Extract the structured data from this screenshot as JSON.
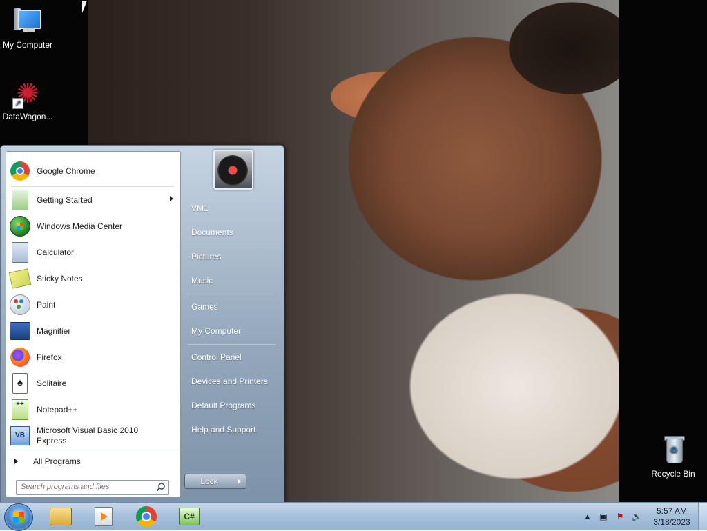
{
  "desktop": {
    "icons": [
      {
        "label": "My Computer",
        "icon": "computer-icon"
      },
      {
        "label": "DataWagon...",
        "icon": "datawagon-icon"
      },
      {
        "label": "Recycle Bin",
        "icon": "recycle-bin-icon"
      }
    ]
  },
  "start_menu": {
    "pinned": [
      {
        "label": "Google Chrome",
        "icon": "chrome-icon"
      }
    ],
    "recent": [
      {
        "label": "Getting Started",
        "icon": "getting-started-icon",
        "has_submenu": true
      },
      {
        "label": "Windows Media Center",
        "icon": "windows-media-center-icon"
      },
      {
        "label": "Calculator",
        "icon": "calculator-icon"
      },
      {
        "label": "Sticky Notes",
        "icon": "sticky-notes-icon"
      },
      {
        "label": "Paint",
        "icon": "paint-icon"
      },
      {
        "label": "Magnifier",
        "icon": "magnifier-icon"
      },
      {
        "label": "Firefox",
        "icon": "firefox-icon"
      },
      {
        "label": "Solitaire",
        "icon": "solitaire-icon"
      },
      {
        "label": "Notepad++",
        "icon": "notepad-plus-plus-icon"
      },
      {
        "label_line1": "Microsoft Visual Basic 2010",
        "label_line2": "Express",
        "icon": "visual-basic-icon"
      }
    ],
    "all_programs": "All Programs",
    "search_placeholder": "Search programs and files",
    "right_items": [
      {
        "label": "VM1"
      },
      {
        "label": "Documents"
      },
      {
        "label": "Pictures"
      },
      {
        "label": "Music"
      },
      {
        "label": "Games"
      },
      {
        "label": "My Computer"
      },
      {
        "label": "Control Panel"
      },
      {
        "label": "Devices and Printers"
      },
      {
        "label": "Default Programs"
      },
      {
        "label": "Help and Support"
      }
    ],
    "lock_label": "Lock",
    "solitaire_glyph": "♠",
    "notepad_glyph": "++",
    "vb_glyph": "VB"
  },
  "taskbar": {
    "pinned": [
      {
        "icon": "windows-explorer-icon"
      },
      {
        "icon": "media-player-icon"
      },
      {
        "icon": "chrome-icon"
      },
      {
        "icon": "csharp-icon",
        "glyph": "C#"
      }
    ],
    "tray": {
      "chevron_glyph": "▲",
      "network_glyph": "▣",
      "flag_glyph": "⚑",
      "volume_glyph": "🔊"
    },
    "clock": {
      "time": "5:57 AM",
      "date": "3/18/2023"
    }
  },
  "colors": {
    "taskbar_top": "#c9d9ea",
    "start_menu_accent": "#95a8bc"
  }
}
